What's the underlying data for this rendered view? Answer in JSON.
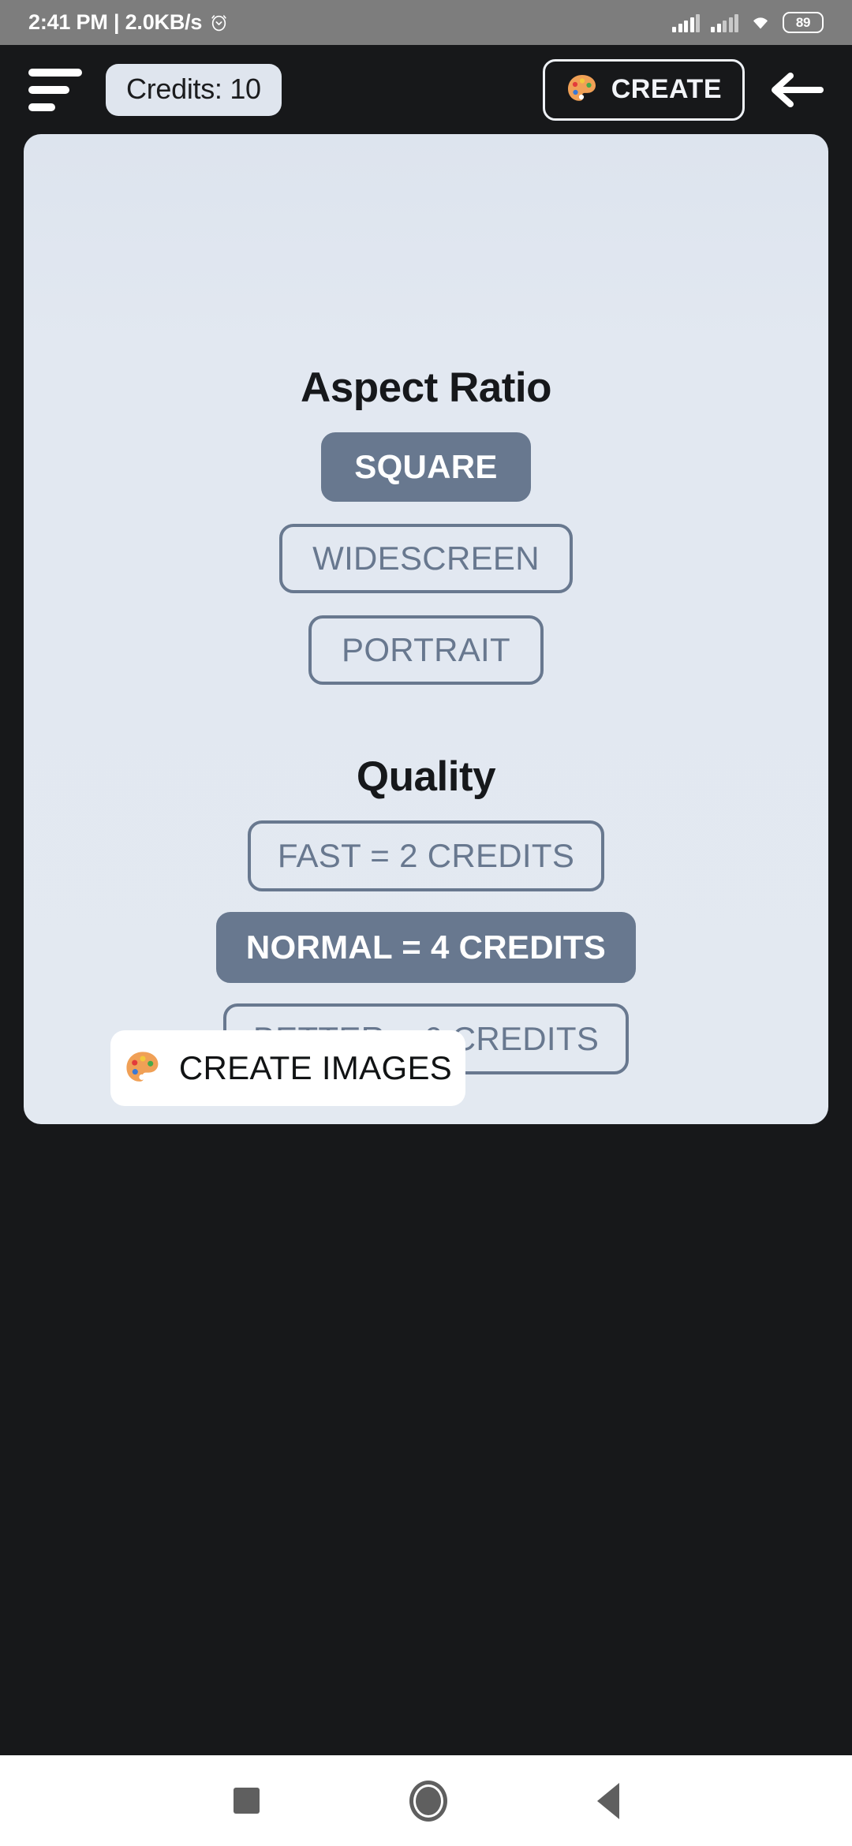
{
  "status_bar": {
    "time_and_network": "2:41 PM | 2.0KB/s",
    "alarm_icon": "alarm-clock-icon",
    "signal_1_icon": "cellular-signal-icon",
    "signal_2_icon": "cellular-signal-icon",
    "wifi_icon": "wifi-icon",
    "battery_level": "89"
  },
  "app_bar": {
    "menu_icon": "hamburger-menu-icon",
    "credits_label": "Credits: 10",
    "create_button": {
      "icon": "palette-icon",
      "label": "CREATE"
    },
    "back_icon": "arrow-left-icon"
  },
  "main": {
    "aspect_ratio": {
      "title": "Aspect Ratio",
      "options": [
        {
          "label": "SQUARE",
          "selected": true
        },
        {
          "label": "WIDESCREEN",
          "selected": false
        },
        {
          "label": "PORTRAIT",
          "selected": false
        }
      ]
    },
    "quality": {
      "title": "Quality",
      "options": [
        {
          "label": "FAST = 2 CREDITS",
          "selected": false
        },
        {
          "label": "NORMAL = 4 CREDITS",
          "selected": true
        },
        {
          "label": "BETTER = 6 CREDITS",
          "selected": false
        }
      ]
    },
    "primary_action": {
      "icon": "palette-icon",
      "label": "CREATE IMAGES"
    }
  },
  "nav_bar": {
    "recents_icon": "square-recents-icon",
    "home_icon": "circle-home-icon",
    "back_icon": "triangle-back-icon"
  },
  "colors": {
    "accent_slate": "#68788f",
    "card_bg": "#e2e8f1",
    "app_bar_bg": "#17181a",
    "status_bar_bg": "#7d7d7d"
  }
}
